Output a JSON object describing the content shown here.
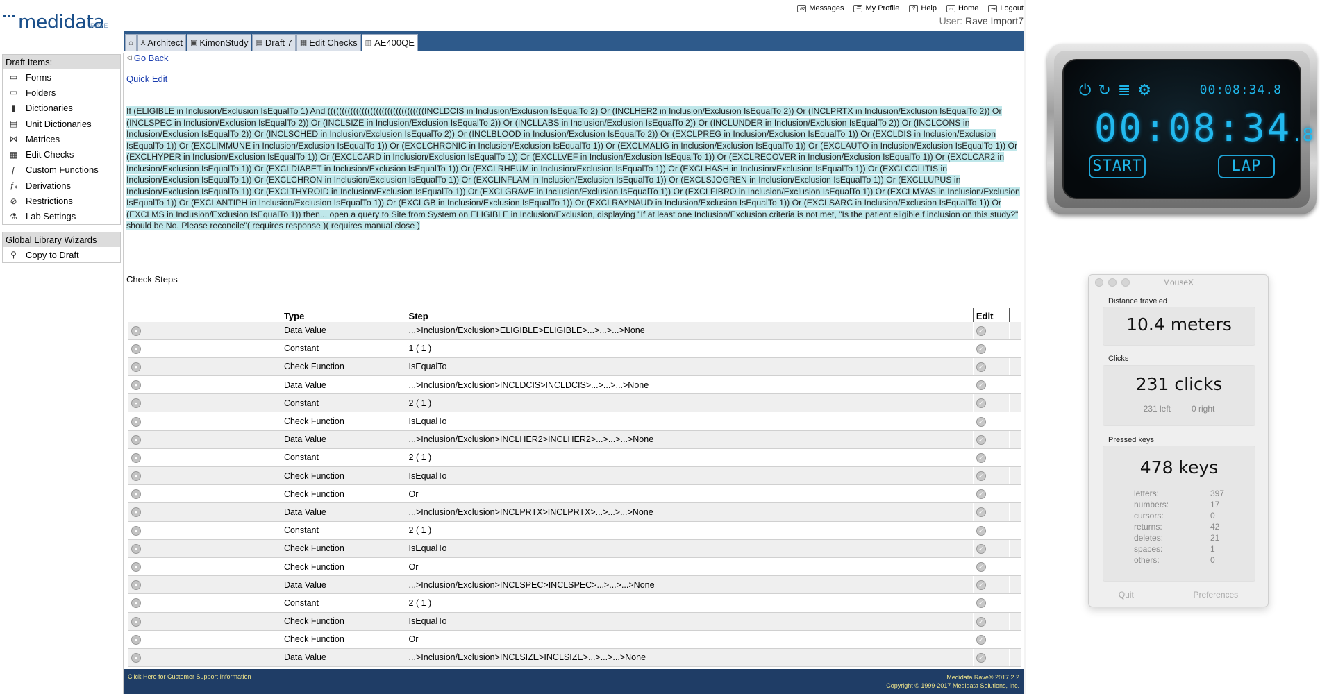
{
  "header": {
    "logo": "medidata",
    "logo_sub": "RAVE",
    "links": [
      "Messages",
      "My Profile",
      "Help",
      "Home",
      "Logout"
    ],
    "user_label": "User:",
    "user_name": "Rave Import7"
  },
  "tabs": [
    {
      "label": "",
      "icon": "home-icon"
    },
    {
      "label": "Architect",
      "icon": "architect-icon"
    },
    {
      "label": "KimonStudy",
      "icon": "study-icon"
    },
    {
      "label": "Draft 7",
      "icon": "draft-icon"
    },
    {
      "label": "Edit Checks",
      "icon": "edit-checks-icon"
    },
    {
      "label": "AE400QE",
      "icon": "check-icon"
    }
  ],
  "sidebar": {
    "draft_title": "Draft Items:",
    "draft_items": [
      {
        "label": "Forms",
        "icon": "forms-icon"
      },
      {
        "label": "Folders",
        "icon": "folders-icon"
      },
      {
        "label": "Dictionaries",
        "icon": "dictionaries-icon"
      },
      {
        "label": "Unit Dictionaries",
        "icon": "unit-dictionaries-icon"
      },
      {
        "label": "Matrices",
        "icon": "matrices-icon"
      },
      {
        "label": "Edit Checks",
        "icon": "edit-checks-icon"
      },
      {
        "label": "Custom Functions",
        "icon": "custom-functions-icon"
      },
      {
        "label": "Derivations",
        "icon": "derivations-icon"
      },
      {
        "label": "Restrictions",
        "icon": "restrictions-icon"
      },
      {
        "label": "Lab Settings",
        "icon": "lab-settings-icon"
      }
    ],
    "wizard_title": "Global Library Wizards",
    "wizard_items": [
      {
        "label": "Copy to Draft",
        "icon": "wand-icon"
      }
    ]
  },
  "content": {
    "go_back": "Go Back",
    "quick_edit": "Quick Edit",
    "rule_text": "If (ELIGIBLE in Inclusion/Exclusion IsEqualTo 1) And ((((((((((((((((((((((((((((((((((INCLDCIS in Inclusion/Exclusion IsEqualTo 2) Or (INCLHER2 in Inclusion/Exclusion IsEqualTo 2)) Or (INCLPRTX in Inclusion/Exclusion IsEqualTo 2)) Or (INCLSPEC in Inclusion/Exclusion IsEqualTo 2)) Or (INCLSIZE in Inclusion/Exclusion IsEqualTo 2)) Or (INCLLABS in Inclusion/Exclusion IsEqualTo 2)) Or (INCLUNDER in Inclusion/Exclusion IsEqualTo 2)) Or (INCLCONS in Inclusion/Exclusion IsEqualTo 2)) Or (INCLSCHED in Inclusion/Exclusion IsEqualTo 2)) Or (INCLBLOOD in Inclusion/Exclusion IsEqualTo 2)) Or (EXCLPREG in Inclusion/Exclusion IsEqualTo 1)) Or (EXCLDIS in Inclusion/Exclusion IsEqualTo 1)) Or (EXCLIMMUNE in Inclusion/Exclusion IsEqualTo 1)) Or (EXCLCHRONIC in Inclusion/Exclusion IsEqualTo 1)) Or (EXCLMALIG in Inclusion/Exclusion IsEqualTo 1)) Or (EXCLAUTO in Inclusion/Exclusion IsEqualTo 1)) Or (EXCLHYPER in Inclusion/Exclusion IsEqualTo 1)) Or (EXCLCARD in Inclusion/Exclusion IsEqualTo 1)) Or (EXCLLVEF in Inclusion/Exclusion IsEqualTo 1)) Or (EXCLRECOVER in Inclusion/Exclusion IsEqualTo 1)) Or (EXCLCAR2 in Inclusion/Exclusion IsEqualTo 1)) Or (EXCLDIABET in Inclusion/Exclusion IsEqualTo 1)) Or (EXCLRHEUM in Inclusion/Exclusion IsEqualTo 1)) Or (EXCLHASH in Inclusion/Exclusion IsEqualTo 1)) Or (EXCLCOLITIS in Inclusion/Exclusion IsEqualTo 1)) Or (EXCLCHRON in Inclusion/Exclusion IsEqualTo 1)) Or (EXCLINFLAM in Inclusion/Exclusion IsEqualTo 1)) Or (EXCLSJOGREN in Inclusion/Exclusion IsEqualTo 1)) Or (EXCLLUPUS in Inclusion/Exclusion IsEqualTo 1)) Or (EXCLTHYROID in Inclusion/Exclusion IsEqualTo 1)) Or (EXCLGRAVE in Inclusion/Exclusion IsEqualTo 1)) Or (EXCLFIBRO in Inclusion/Exclusion IsEqualTo 1)) Or (EXCLMYAS in Inclusion/Exclusion IsEqualTo 1)) Or (EXCLANTIPH in Inclusion/Exclusion IsEqualTo 1)) Or (EXCLGB in Inclusion/Exclusion IsEqualTo 1)) Or (EXCLRAYNAUD in Inclusion/Exclusion IsEqualTo 1)) Or (EXCLSARC in Inclusion/Exclusion IsEqualTo 1)) Or (EXCLMS in Inclusion/Exclusion IsEqualTo 1)) then... open a query to Site from System on ELIGIBLE in Inclusion/Exclusion, displaying \"If at least one Inclusion/Exclusion criteria is not met, \"Is the patient eligible f inclusion on this study?\" should be No. Please reconcile\"( requires response )( requires manual close )",
    "check_steps_title": "Check Steps",
    "table_headers": [
      "",
      "Type",
      "Step",
      "Edit",
      ""
    ],
    "steps": [
      {
        "type": "Data Value",
        "step": "...>Inclusion/Exclusion>ELIGIBLE>ELIGIBLE>...>...>...>None"
      },
      {
        "type": "Constant",
        "step": "1 ( 1 )"
      },
      {
        "type": "Check Function",
        "step": "IsEqualTo"
      },
      {
        "type": "Data Value",
        "step": "...>Inclusion/Exclusion>INCLDCIS>INCLDCIS>...>...>...>None"
      },
      {
        "type": "Constant",
        "step": "2 ( 1 )"
      },
      {
        "type": "Check Function",
        "step": "IsEqualTo"
      },
      {
        "type": "Data Value",
        "step": "...>Inclusion/Exclusion>INCLHER2>INCLHER2>...>...>...>None"
      },
      {
        "type": "Constant",
        "step": "2 ( 1 )"
      },
      {
        "type": "Check Function",
        "step": "IsEqualTo"
      },
      {
        "type": "Check Function",
        "step": "Or"
      },
      {
        "type": "Data Value",
        "step": "...>Inclusion/Exclusion>INCLPRTX>INCLPRTX>...>...>...>None"
      },
      {
        "type": "Constant",
        "step": "2 ( 1 )"
      },
      {
        "type": "Check Function",
        "step": "IsEqualTo"
      },
      {
        "type": "Check Function",
        "step": "Or"
      },
      {
        "type": "Data Value",
        "step": "...>Inclusion/Exclusion>INCLSPEC>INCLSPEC>...>...>...>None"
      },
      {
        "type": "Constant",
        "step": "2 ( 1 )"
      },
      {
        "type": "Check Function",
        "step": "IsEqualTo"
      },
      {
        "type": "Check Function",
        "step": "Or"
      },
      {
        "type": "Data Value",
        "step": "...>Inclusion/Exclusion>INCLSIZE>INCLSIZE>...>...>...>None"
      }
    ]
  },
  "footer": {
    "support_link": "Click Here for Customer Support Information",
    "version": "Medidata Rave® 2017.2.2",
    "copyright": "Copyright © 1999-2017 Medidata Solutions, Inc."
  },
  "stopwatch": {
    "small_time": "00:08:34.8",
    "big_time": "00:08:34",
    "big_fraction": ".8",
    "start_label": "START",
    "lap_label": "LAP",
    "accent_color": "#1fb6ea"
  },
  "mousex": {
    "title": "MouseX",
    "distance_label": "Distance traveled",
    "distance_value": "10.4 meters",
    "clicks_label": "Clicks",
    "clicks_value": "231 clicks",
    "clicks_left": "231 left",
    "clicks_right": "0 right",
    "keys_label": "Pressed keys",
    "keys_value": "478 keys",
    "key_breakdown": [
      {
        "label": "letters:",
        "value": "397"
      },
      {
        "label": "numbers:",
        "value": "17"
      },
      {
        "label": "cursors:",
        "value": "0"
      },
      {
        "label": "returns:",
        "value": "42"
      },
      {
        "label": "deletes:",
        "value": "21"
      },
      {
        "label": "spaces:",
        "value": "1"
      },
      {
        "label": "others:",
        "value": "0"
      }
    ],
    "quit_label": "Quit",
    "preferences_label": "Preferences"
  }
}
